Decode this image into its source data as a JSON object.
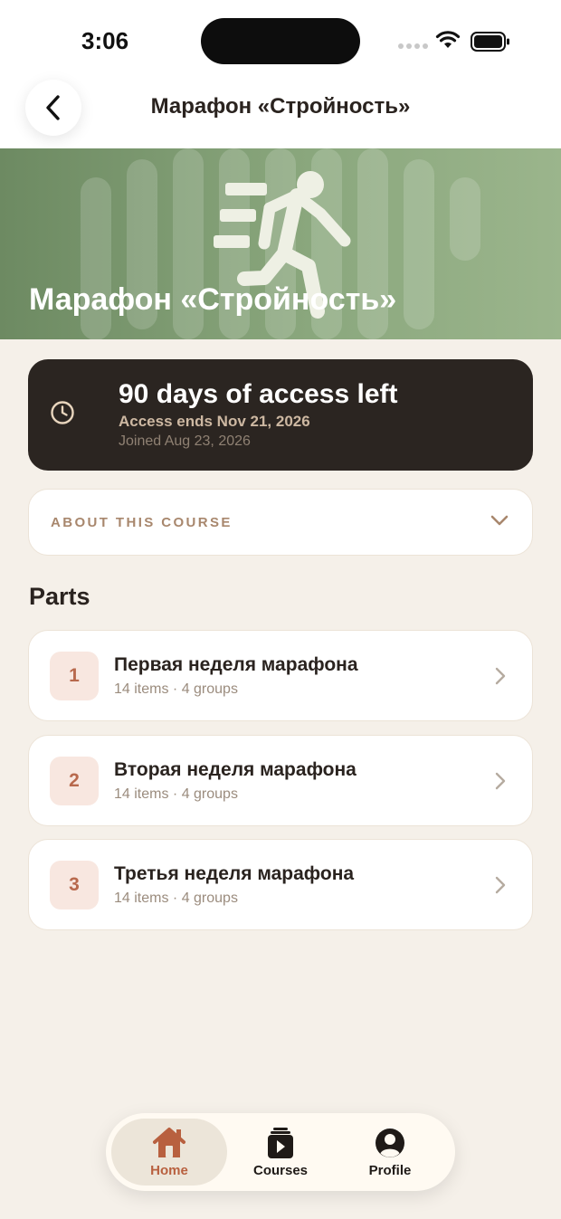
{
  "status_bar": {
    "time": "3:06"
  },
  "nav": {
    "title": "Марафон «Стройность»",
    "back_icon": "chevron-left-icon"
  },
  "hero": {
    "title": "Марафон «Стройность»",
    "icon": "running-person-icon"
  },
  "access": {
    "title": "90 days of access left",
    "ends": "Access ends Nov 21, 2026",
    "joined": "Joined Aug 23, 2026",
    "icon": "clock-icon"
  },
  "about": {
    "label": "ABOUT THIS COURSE",
    "icon": "chevron-down-icon"
  },
  "parts": {
    "heading": "Parts",
    "items": [
      {
        "number": "1",
        "title": "Первая неделя марафона",
        "meta": "14 items · 4 groups"
      },
      {
        "number": "2",
        "title": "Вторая неделя марафона",
        "meta": "14 items · 4 groups"
      },
      {
        "number": "3",
        "title": "Третья неделя марафона",
        "meta": "14 items · 4 groups"
      }
    ]
  },
  "tabbar": {
    "tabs": [
      {
        "label": "Home",
        "icon": "home-icon",
        "active": true
      },
      {
        "label": "Courses",
        "icon": "courses-icon",
        "active": false
      },
      {
        "label": "Profile",
        "icon": "profile-icon",
        "active": false
      }
    ]
  },
  "colors": {
    "background": "#f5f0e9",
    "accent": "#b8603f",
    "hero_green": "#7f9c73",
    "dark_card": "#2b2521"
  }
}
